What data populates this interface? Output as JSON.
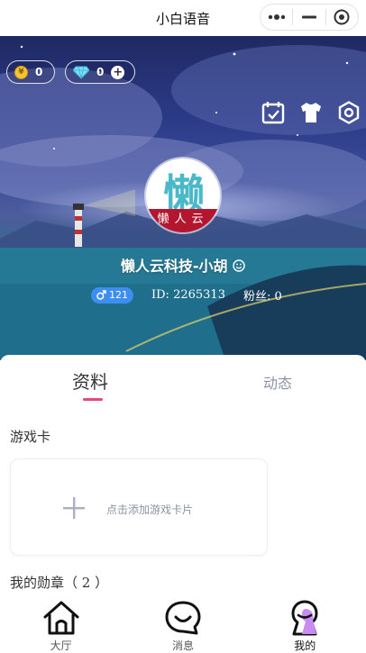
{
  "titlebar": {
    "title": "小白语音",
    "more_icon": "more-dots-icon",
    "minimize_icon": "minimize-icon",
    "close_icon": "target-close-icon"
  },
  "profile": {
    "coins": "0",
    "gems": "0",
    "coin_symbol": "¥",
    "avatar_text": "懒",
    "avatar_banner_text": "懒人云",
    "username": "懒人云科技-小胡",
    "level": "121",
    "id_text": "ID: 2265313",
    "fans_text": "粉丝: 0",
    "colors": {
      "gender_badge": "#3d8ef0",
      "coin": "#f3c531"
    }
  },
  "header_icons": [
    "calendar-check-icon",
    "tshirt-icon",
    "settings-hexagon-icon"
  ],
  "tabs": [
    {
      "label": "资料",
      "active": true
    },
    {
      "label": "动态",
      "active": false
    }
  ],
  "sections": {
    "game_cards_title": "游戏卡",
    "add_card_text": "点击添加游戏卡片",
    "medals_title": "我的勋章",
    "medals_count_text": "（ 2 ）"
  },
  "bottom_nav": [
    {
      "label": "大厅",
      "icon": "home-icon",
      "active": false
    },
    {
      "label": "消息",
      "icon": "message-smile-icon",
      "active": false
    },
    {
      "label": "我的",
      "icon": "profile-icon",
      "active": true
    }
  ],
  "accent_color": "#e8467c"
}
